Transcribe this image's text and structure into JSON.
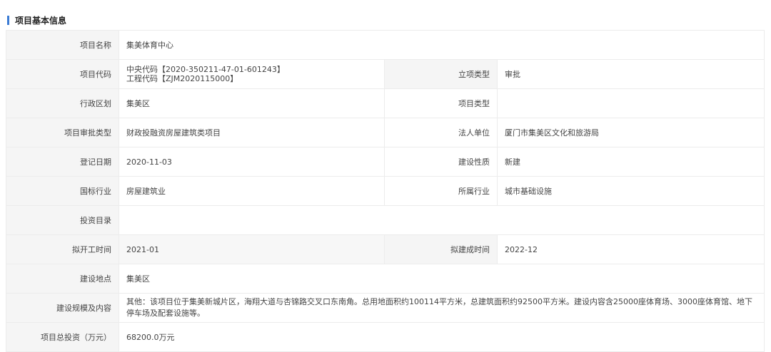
{
  "section": {
    "title": "项目基本信息"
  },
  "fields": {
    "name_label": "项目名称",
    "name_value": "集美体育中心",
    "code_label": "项目代码",
    "code_line1": "中央代码【2020-350211-47-01-601243】",
    "code_line2": "工程代码【ZJM2020115000】",
    "approval_label": "立项类型",
    "approval_value": "审批",
    "district_label": "行政区划",
    "district_value": "集美区",
    "project_type_label": "项目类型",
    "project_type_value": "",
    "review_type_label": "项目审批类型",
    "review_type_value": "财政投融资房屋建筑类项目",
    "legal_entity_label": "法人单位",
    "legal_entity_value": "厦门市集美区文化和旅游局",
    "reg_date_label": "登记日期",
    "reg_date_value": "2020-11-03",
    "build_nature_label": "建设性质",
    "build_nature_value": "新建",
    "national_industry_label": "国标行业",
    "national_industry_value": "房屋建筑业",
    "industry_label": "所属行业",
    "industry_value": "城市基础设施",
    "invest_catalog_label": "投资目录",
    "invest_catalog_value": "",
    "start_label": "拟开工时间",
    "start_value": "2021-01",
    "finish_label": "拟建成时间",
    "finish_value": "2022-12",
    "location_label": "建设地点",
    "location_value": "集美区",
    "scale_label": "建设规模及内容",
    "scale_value": "其他：该项目位于集美新城片区，海翔大道与杏锦路交叉口东南角。总用地面积约100114平方米，总建筑面积约92500平方米。建设内容含25000座体育场、3000座体育馆、地下停车场及配套设施等。",
    "total_invest_label": "项目总投资（万元）",
    "total_invest_value": "68200.0万元"
  }
}
